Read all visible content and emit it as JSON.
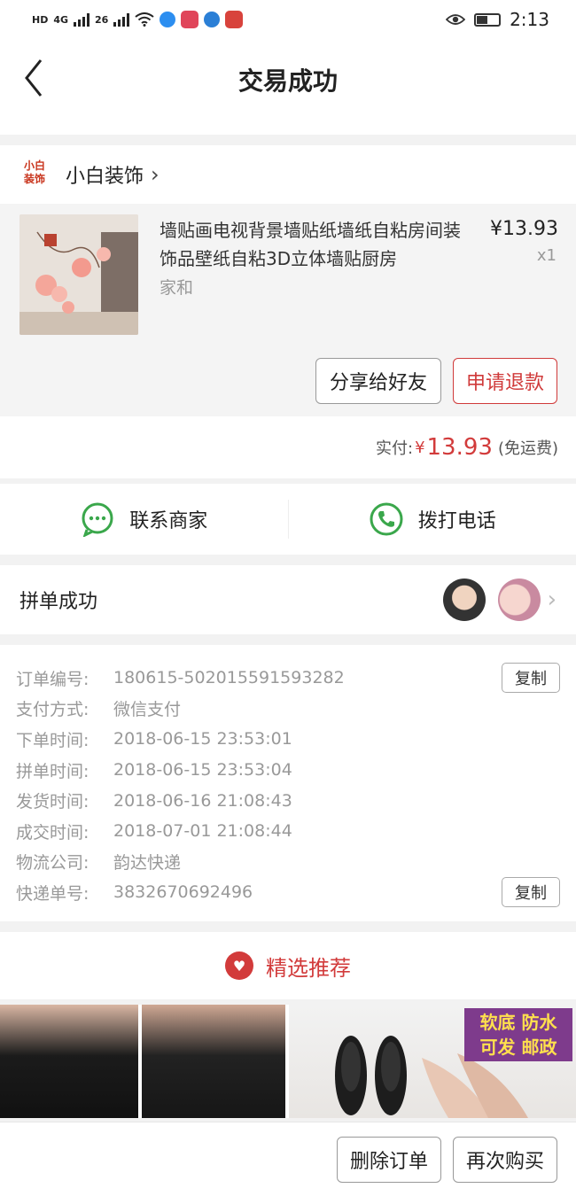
{
  "status_bar": {
    "hd": "HD",
    "net1": "4G",
    "net2": "26",
    "time": "2:13"
  },
  "nav": {
    "title": "交易成功"
  },
  "shop": {
    "logo_line1": "小白",
    "logo_line2": "装饰",
    "name": "小白装饰"
  },
  "goods": {
    "title": "墙贴画电视背景墙贴纸墙纸自粘房间装饰品壁纸自粘3D立体墙贴厨房",
    "spec": "家和",
    "price": "¥13.93",
    "qty": "x1",
    "share_label": "分享给好友",
    "refund_label": "申请退款"
  },
  "payment": {
    "label": "实付:",
    "currency": "¥",
    "amount": "13.93",
    "note": "(免运费)"
  },
  "contact": {
    "merchant_label": "联系商家",
    "phone_label": "拨打电话"
  },
  "group": {
    "title": "拼单成功"
  },
  "order_info": {
    "copy_label": "复制",
    "rows": [
      {
        "label": "订单编号:",
        "value": "180615-502015591593282"
      },
      {
        "label": "支付方式:",
        "value": "微信支付"
      },
      {
        "label": "下单时间:",
        "value": "2018-06-15 23:53:01"
      },
      {
        "label": "拼单时间:",
        "value": "2018-06-15 23:53:04"
      },
      {
        "label": "发货时间:",
        "value": "2018-06-16 21:08:43"
      },
      {
        "label": "成交时间:",
        "value": "2018-07-01 21:08:44"
      },
      {
        "label": "物流公司:",
        "value": "韵达快递"
      },
      {
        "label": "快递单号:",
        "value": "3832670692496"
      }
    ]
  },
  "recommend": {
    "title": "精选推荐",
    "promo_line1": "软底 防水",
    "promo_line2": "可发 邮政"
  },
  "bottom": {
    "delete_label": "删除订单",
    "rebuy_label": "再次购买"
  },
  "colors": {
    "accent_red": "#d23b3b",
    "wechat_green": "#3aa74b"
  }
}
